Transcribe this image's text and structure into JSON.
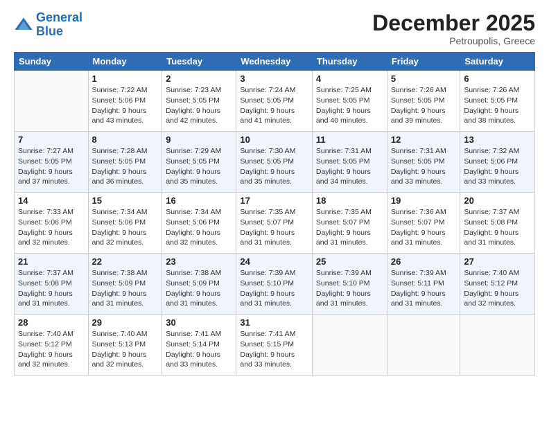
{
  "logo": {
    "line1": "General",
    "line2": "Blue"
  },
  "header": {
    "month": "December 2025",
    "location": "Petroupolis, Greece"
  },
  "weekdays": [
    "Sunday",
    "Monday",
    "Tuesday",
    "Wednesday",
    "Thursday",
    "Friday",
    "Saturday"
  ],
  "weeks": [
    [
      {
        "day": "",
        "sunrise": "",
        "sunset": "",
        "daylight": ""
      },
      {
        "day": "1",
        "sunrise": "Sunrise: 7:22 AM",
        "sunset": "Sunset: 5:06 PM",
        "daylight": "Daylight: 9 hours and 43 minutes."
      },
      {
        "day": "2",
        "sunrise": "Sunrise: 7:23 AM",
        "sunset": "Sunset: 5:05 PM",
        "daylight": "Daylight: 9 hours and 42 minutes."
      },
      {
        "day": "3",
        "sunrise": "Sunrise: 7:24 AM",
        "sunset": "Sunset: 5:05 PM",
        "daylight": "Daylight: 9 hours and 41 minutes."
      },
      {
        "day": "4",
        "sunrise": "Sunrise: 7:25 AM",
        "sunset": "Sunset: 5:05 PM",
        "daylight": "Daylight: 9 hours and 40 minutes."
      },
      {
        "day": "5",
        "sunrise": "Sunrise: 7:26 AM",
        "sunset": "Sunset: 5:05 PM",
        "daylight": "Daylight: 9 hours and 39 minutes."
      },
      {
        "day": "6",
        "sunrise": "Sunrise: 7:26 AM",
        "sunset": "Sunset: 5:05 PM",
        "daylight": "Daylight: 9 hours and 38 minutes."
      }
    ],
    [
      {
        "day": "7",
        "sunrise": "Sunrise: 7:27 AM",
        "sunset": "Sunset: 5:05 PM",
        "daylight": "Daylight: 9 hours and 37 minutes."
      },
      {
        "day": "8",
        "sunrise": "Sunrise: 7:28 AM",
        "sunset": "Sunset: 5:05 PM",
        "daylight": "Daylight: 9 hours and 36 minutes."
      },
      {
        "day": "9",
        "sunrise": "Sunrise: 7:29 AM",
        "sunset": "Sunset: 5:05 PM",
        "daylight": "Daylight: 9 hours and 35 minutes."
      },
      {
        "day": "10",
        "sunrise": "Sunrise: 7:30 AM",
        "sunset": "Sunset: 5:05 PM",
        "daylight": "Daylight: 9 hours and 35 minutes."
      },
      {
        "day": "11",
        "sunrise": "Sunrise: 7:31 AM",
        "sunset": "Sunset: 5:05 PM",
        "daylight": "Daylight: 9 hours and 34 minutes."
      },
      {
        "day": "12",
        "sunrise": "Sunrise: 7:31 AM",
        "sunset": "Sunset: 5:05 PM",
        "daylight": "Daylight: 9 hours and 33 minutes."
      },
      {
        "day": "13",
        "sunrise": "Sunrise: 7:32 AM",
        "sunset": "Sunset: 5:06 PM",
        "daylight": "Daylight: 9 hours and 33 minutes."
      }
    ],
    [
      {
        "day": "14",
        "sunrise": "Sunrise: 7:33 AM",
        "sunset": "Sunset: 5:06 PM",
        "daylight": "Daylight: 9 hours and 32 minutes."
      },
      {
        "day": "15",
        "sunrise": "Sunrise: 7:34 AM",
        "sunset": "Sunset: 5:06 PM",
        "daylight": "Daylight: 9 hours and 32 minutes."
      },
      {
        "day": "16",
        "sunrise": "Sunrise: 7:34 AM",
        "sunset": "Sunset: 5:06 PM",
        "daylight": "Daylight: 9 hours and 32 minutes."
      },
      {
        "day": "17",
        "sunrise": "Sunrise: 7:35 AM",
        "sunset": "Sunset: 5:07 PM",
        "daylight": "Daylight: 9 hours and 31 minutes."
      },
      {
        "day": "18",
        "sunrise": "Sunrise: 7:35 AM",
        "sunset": "Sunset: 5:07 PM",
        "daylight": "Daylight: 9 hours and 31 minutes."
      },
      {
        "day": "19",
        "sunrise": "Sunrise: 7:36 AM",
        "sunset": "Sunset: 5:07 PM",
        "daylight": "Daylight: 9 hours and 31 minutes."
      },
      {
        "day": "20",
        "sunrise": "Sunrise: 7:37 AM",
        "sunset": "Sunset: 5:08 PM",
        "daylight": "Daylight: 9 hours and 31 minutes."
      }
    ],
    [
      {
        "day": "21",
        "sunrise": "Sunrise: 7:37 AM",
        "sunset": "Sunset: 5:08 PM",
        "daylight": "Daylight: 9 hours and 31 minutes."
      },
      {
        "day": "22",
        "sunrise": "Sunrise: 7:38 AM",
        "sunset": "Sunset: 5:09 PM",
        "daylight": "Daylight: 9 hours and 31 minutes."
      },
      {
        "day": "23",
        "sunrise": "Sunrise: 7:38 AM",
        "sunset": "Sunset: 5:09 PM",
        "daylight": "Daylight: 9 hours and 31 minutes."
      },
      {
        "day": "24",
        "sunrise": "Sunrise: 7:39 AM",
        "sunset": "Sunset: 5:10 PM",
        "daylight": "Daylight: 9 hours and 31 minutes."
      },
      {
        "day": "25",
        "sunrise": "Sunrise: 7:39 AM",
        "sunset": "Sunset: 5:10 PM",
        "daylight": "Daylight: 9 hours and 31 minutes."
      },
      {
        "day": "26",
        "sunrise": "Sunrise: 7:39 AM",
        "sunset": "Sunset: 5:11 PM",
        "daylight": "Daylight: 9 hours and 31 minutes."
      },
      {
        "day": "27",
        "sunrise": "Sunrise: 7:40 AM",
        "sunset": "Sunset: 5:12 PM",
        "daylight": "Daylight: 9 hours and 32 minutes."
      }
    ],
    [
      {
        "day": "28",
        "sunrise": "Sunrise: 7:40 AM",
        "sunset": "Sunset: 5:12 PM",
        "daylight": "Daylight: 9 hours and 32 minutes."
      },
      {
        "day": "29",
        "sunrise": "Sunrise: 7:40 AM",
        "sunset": "Sunset: 5:13 PM",
        "daylight": "Daylight: 9 hours and 32 minutes."
      },
      {
        "day": "30",
        "sunrise": "Sunrise: 7:41 AM",
        "sunset": "Sunset: 5:14 PM",
        "daylight": "Daylight: 9 hours and 33 minutes."
      },
      {
        "day": "31",
        "sunrise": "Sunrise: 7:41 AM",
        "sunset": "Sunset: 5:15 PM",
        "daylight": "Daylight: 9 hours and 33 minutes."
      },
      {
        "day": "",
        "sunrise": "",
        "sunset": "",
        "daylight": ""
      },
      {
        "day": "",
        "sunrise": "",
        "sunset": "",
        "daylight": ""
      },
      {
        "day": "",
        "sunrise": "",
        "sunset": "",
        "daylight": ""
      }
    ]
  ]
}
